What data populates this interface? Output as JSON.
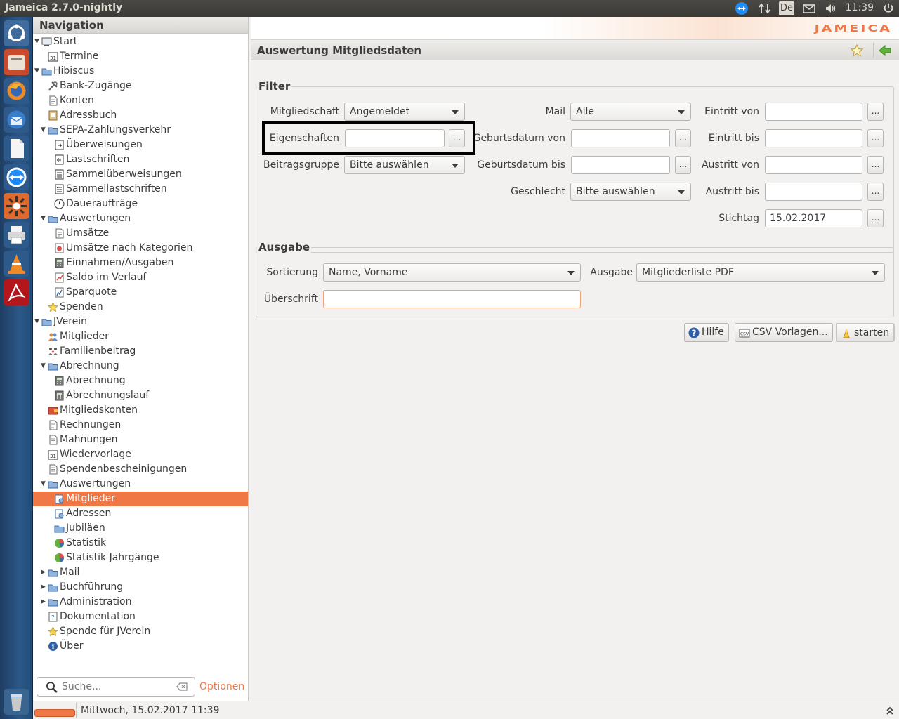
{
  "window": {
    "title": "Jameica 2.7.0-nightly",
    "clock": "11:39",
    "keyboard_layout": "De"
  },
  "navigation": {
    "header": "Navigation",
    "items": [
      {
        "label": "Start",
        "level": 0,
        "expanded": true,
        "icon": "computer-icon"
      },
      {
        "label": "Termine",
        "level": 1,
        "icon": "calendar-icon"
      },
      {
        "label": "Hibiscus",
        "level": 0,
        "expanded": true,
        "icon": "folder-icon"
      },
      {
        "label": "Bank-Zugänge",
        "level": 1,
        "icon": "tools-icon"
      },
      {
        "label": "Konten",
        "level": 1,
        "icon": "document-icon"
      },
      {
        "label": "Adressbuch",
        "level": 1,
        "icon": "address-book-icon"
      },
      {
        "label": "SEPA-Zahlungsverkehr",
        "level": 1,
        "expanded": true,
        "icon": "folder-icon"
      },
      {
        "label": "Überweisungen",
        "level": 2,
        "icon": "transfer-icon"
      },
      {
        "label": "Lastschriften",
        "level": 2,
        "icon": "debit-icon"
      },
      {
        "label": "Sammelüberweisungen",
        "level": 2,
        "icon": "batch-transfer-icon"
      },
      {
        "label": "Sammellastschriften",
        "level": 2,
        "icon": "batch-debit-icon"
      },
      {
        "label": "Daueraufträge",
        "level": 2,
        "icon": "clock-icon"
      },
      {
        "label": "Auswertungen",
        "level": 1,
        "expanded": true,
        "icon": "folder-icon"
      },
      {
        "label": "Umsätze",
        "level": 2,
        "icon": "document-icon"
      },
      {
        "label": "Umsätze nach Kategorien",
        "level": 2,
        "icon": "category-icon"
      },
      {
        "label": "Einnahmen/Ausgaben",
        "level": 2,
        "icon": "calculator-icon"
      },
      {
        "label": "Saldo im Verlauf",
        "level": 2,
        "icon": "balance-icon"
      },
      {
        "label": "Sparquote",
        "level": 2,
        "icon": "chart-icon"
      },
      {
        "label": "Spenden",
        "level": 1,
        "icon": "star-icon"
      },
      {
        "label": "JVerein",
        "level": 0,
        "expanded": true,
        "icon": "folder-icon"
      },
      {
        "label": "Mitglieder",
        "level": 1,
        "icon": "members-icon"
      },
      {
        "label": "Familienbeitrag",
        "level": 1,
        "icon": "family-icon"
      },
      {
        "label": "Abrechnung",
        "level": 1,
        "expanded": true,
        "icon": "folder-icon"
      },
      {
        "label": "Abrechnung",
        "level": 2,
        "icon": "calculator-icon"
      },
      {
        "label": "Abrechnungslauf",
        "level": 2,
        "icon": "calculator-icon"
      },
      {
        "label": "Mitgliedskonten",
        "level": 1,
        "icon": "wallet-icon"
      },
      {
        "label": "Rechnungen",
        "level": 1,
        "icon": "invoice-icon"
      },
      {
        "label": "Mahnungen",
        "level": 1,
        "icon": "reminder-icon"
      },
      {
        "label": "Wiedervorlage",
        "level": 1,
        "icon": "calendar-icon"
      },
      {
        "label": "Spendenbescheinigungen",
        "level": 1,
        "icon": "certificate-icon"
      },
      {
        "label": "Auswertungen",
        "level": 1,
        "expanded": true,
        "icon": "folder-icon"
      },
      {
        "label": "Mitglieder",
        "level": 2,
        "selected": true,
        "icon": "report-icon"
      },
      {
        "label": "Adressen",
        "level": 2,
        "icon": "report-icon"
      },
      {
        "label": "Jubiläen",
        "level": 2,
        "icon": "folder-icon"
      },
      {
        "label": "Statistik",
        "level": 2,
        "icon": "pie-chart-icon"
      },
      {
        "label": "Statistik Jahrgänge",
        "level": 2,
        "icon": "pie-chart-icon"
      },
      {
        "label": "Mail",
        "level": 1,
        "collapsed": true,
        "icon": "folder-icon"
      },
      {
        "label": "Buchführung",
        "level": 1,
        "collapsed": true,
        "icon": "folder-icon"
      },
      {
        "label": "Administration",
        "level": 1,
        "collapsed": true,
        "icon": "folder-icon"
      },
      {
        "label": "Dokumentation",
        "level": 1,
        "icon": "help-icon"
      },
      {
        "label": "Spende für JVerein",
        "level": 1,
        "icon": "star-icon"
      },
      {
        "label": "Über",
        "level": 1,
        "icon": "info-icon"
      }
    ],
    "search_placeholder": "Suche...",
    "options_label": "Optionen"
  },
  "main": {
    "title": "Auswertung Mitgliedsdaten",
    "filter": {
      "title": "Filter",
      "mitgliedschaft_label": "Mitgliedschaft",
      "mitgliedschaft_value": "Angemeldet",
      "eigenschaften_label": "Eigenschaften",
      "eigenschaften_value": "",
      "beitragsgruppe_label": "Beitragsgruppe",
      "beitragsgruppe_value": "Bitte auswählen",
      "mail_label": "Mail",
      "mail_value": "Alle",
      "geburtsdatum_von_label": "Geburtsdatum von",
      "geburtsdatum_von_value": "",
      "geburtsdatum_bis_label": "Geburtsdatum bis",
      "geburtsdatum_bis_value": "",
      "geschlecht_label": "Geschlecht",
      "geschlecht_value": "Bitte auswählen",
      "eintritt_von_label": "Eintritt von",
      "eintritt_von_value": "",
      "eintritt_bis_label": "Eintritt bis",
      "eintritt_bis_value": "",
      "austritt_von_label": "Austritt von",
      "austritt_von_value": "",
      "austritt_bis_label": "Austritt bis",
      "austritt_bis_value": "",
      "stichtag_label": "Stichtag",
      "stichtag_value": "15.02.2017",
      "dots_label": "..."
    },
    "ausgabe": {
      "title": "Ausgabe",
      "sortierung_label": "Sortierung",
      "sortierung_value": "Name, Vorname",
      "ausgabe_label": "Ausgabe",
      "ausgabe_value": "Mitgliederliste PDF",
      "ueberschrift_label": "Überschrift",
      "ueberschrift_value": ""
    },
    "buttons": {
      "hilfe": "Hilfe",
      "csv": "CSV Vorlagen...",
      "starten": "starten"
    }
  },
  "status": {
    "text": "Mittwoch, 15.02.2017 11:39"
  },
  "colors": {
    "accent": "#f07746",
    "selection": "#f07746",
    "topbar": "#3c3b37"
  }
}
